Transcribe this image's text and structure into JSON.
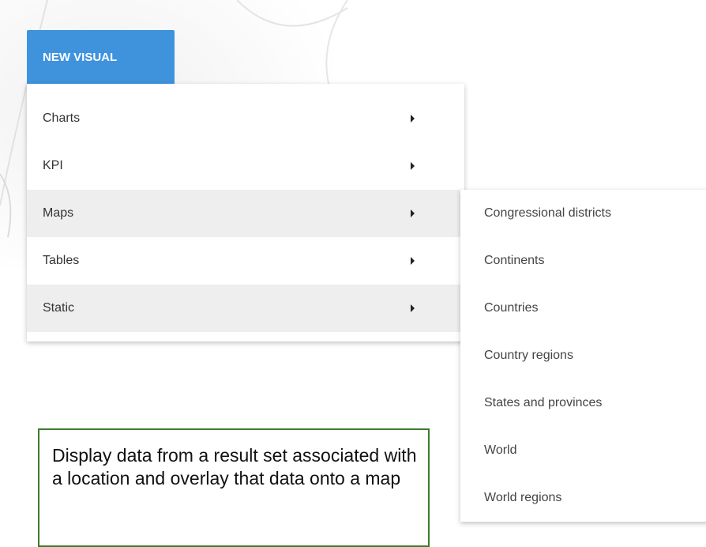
{
  "toolbar": {
    "new_visual_label": "NEW VISUAL"
  },
  "menu": {
    "items": [
      {
        "label": "Charts",
        "has_submenu": true
      },
      {
        "label": "KPI",
        "has_submenu": true
      },
      {
        "label": "Maps",
        "has_submenu": true,
        "active": true
      },
      {
        "label": "Tables",
        "has_submenu": true
      },
      {
        "label": "Static",
        "has_submenu": true,
        "hovered": true
      }
    ],
    "caret_icon": "caret-right-icon"
  },
  "submenu": {
    "parent": "Maps",
    "items": [
      {
        "label": "Congressional districts"
      },
      {
        "label": "Continents"
      },
      {
        "label": "Countries"
      },
      {
        "label": "Country regions"
      },
      {
        "label": "States and provinces"
      },
      {
        "label": "World"
      },
      {
        "label": "World regions"
      }
    ]
  },
  "callout": {
    "text": "Display data from a result set associated with a location and overlay that data onto a map"
  },
  "colors": {
    "accent": "#3f93dd",
    "callout_border": "#3d7a2c",
    "highlight_bg": "#eeeeee"
  }
}
